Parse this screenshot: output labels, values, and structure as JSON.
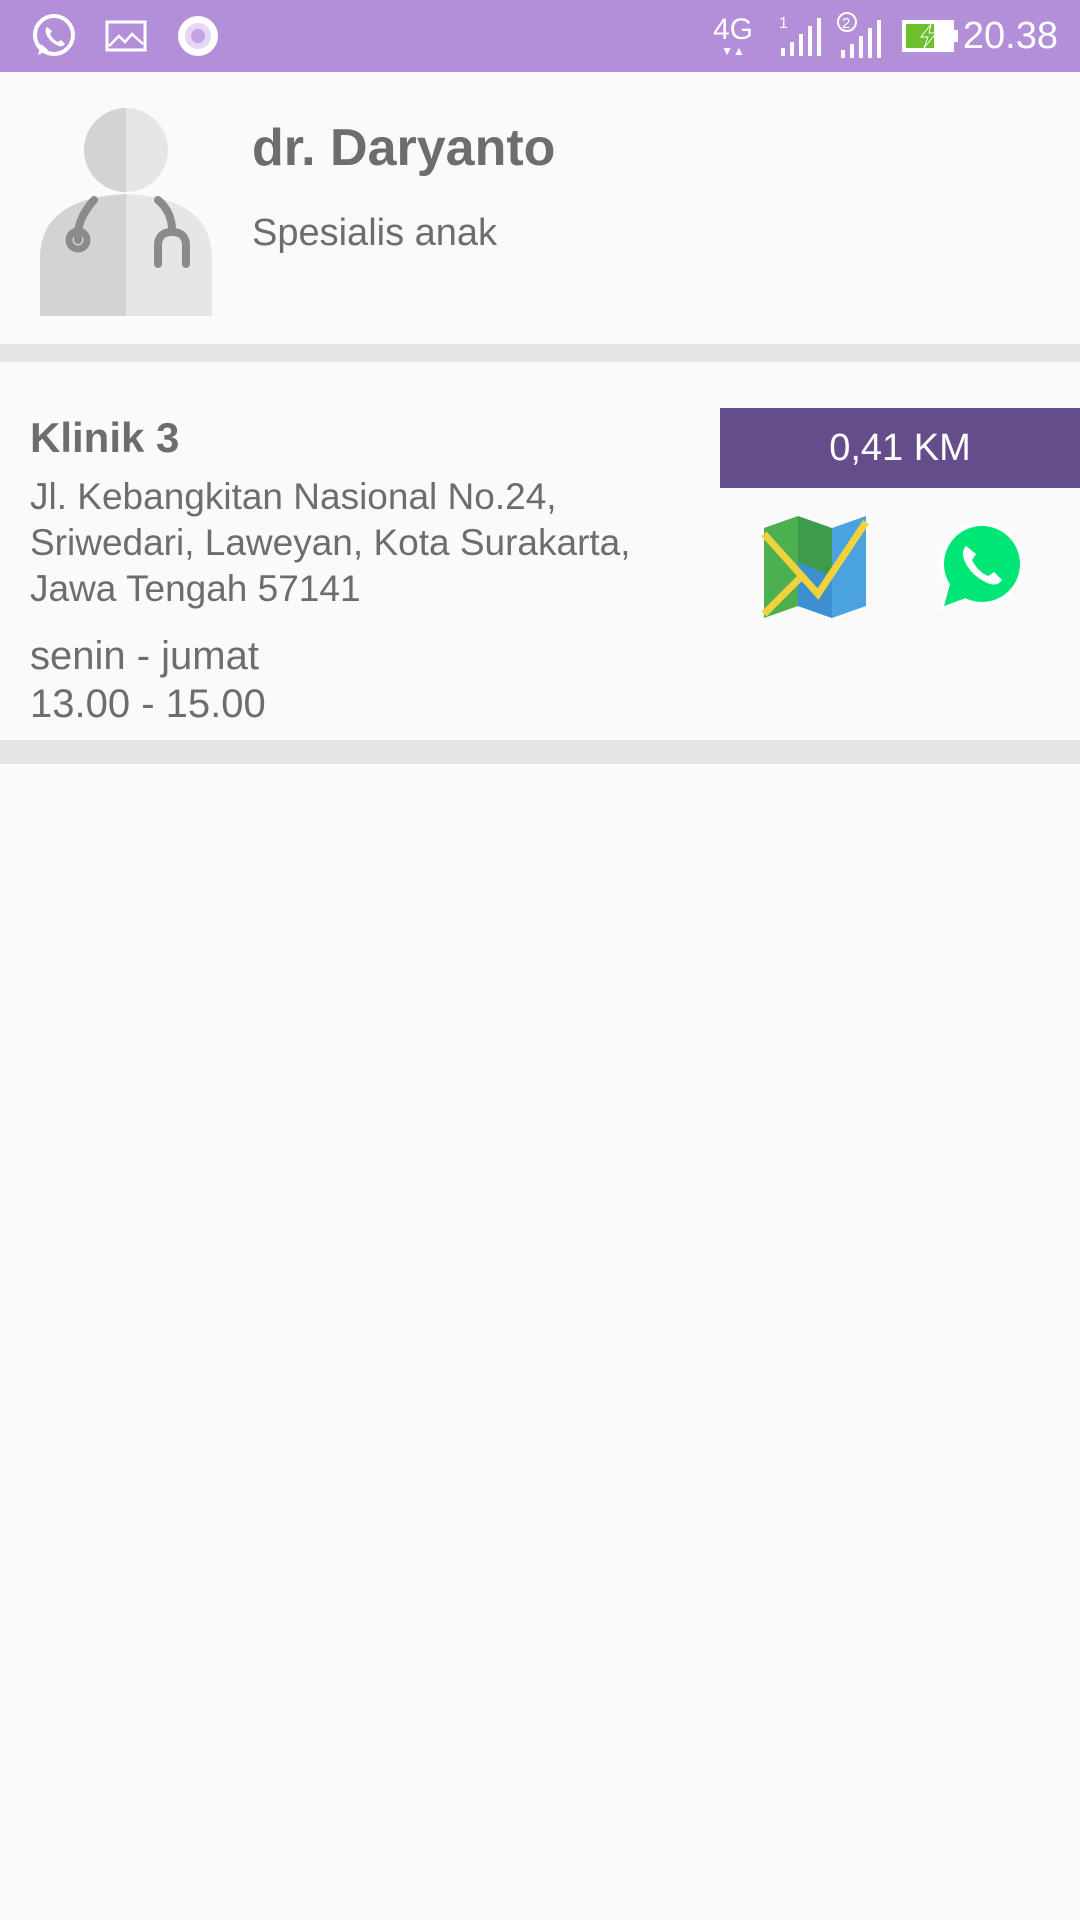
{
  "status_bar": {
    "time": "20.38",
    "network": "4G",
    "sim1": "1",
    "sim2": "2",
    "icons": [
      "whatsapp-icon",
      "gallery-icon",
      "record-icon",
      "signal-icon",
      "battery-charging-icon"
    ],
    "background_color": "#b28fd8"
  },
  "doctor": {
    "name": "dr. Daryanto",
    "specialty": "Spesialis anak",
    "avatar_icon": "doctor-avatar-icon"
  },
  "clinic": {
    "name": "Klinik 3",
    "address": "Jl. Kebangkitan Nasional No.24, Sriwedari, Laweyan, Kota Surakarta, Jawa Tengah 57141",
    "days": "senin - jumat",
    "hours": "13.00 - 15.00",
    "distance": "0,41 KM",
    "distance_badge_color": "#654d8c",
    "actions": {
      "map_icon": "map-icon",
      "whatsapp_icon": "whatsapp-icon"
    }
  },
  "colors": {
    "accent": "#b28fd8",
    "badge": "#654d8c",
    "text": "#6d6d6d",
    "divider": "#e6e6e6",
    "whatsapp_green": "#00e676"
  }
}
